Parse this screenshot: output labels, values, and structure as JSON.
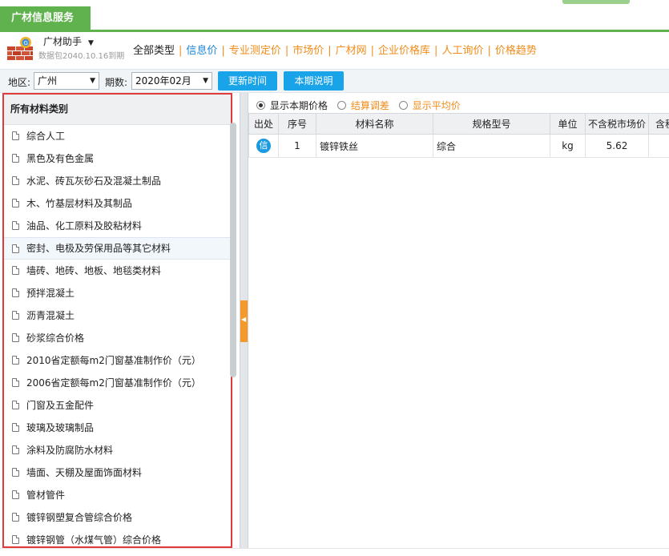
{
  "app": {
    "tab_label": "广材信息服务"
  },
  "header": {
    "assistant_label": "广材助手",
    "caret": "▼",
    "package_text": "数据包2040.10.16到期",
    "nav": [
      {
        "label": "全部类型",
        "style": "black"
      },
      {
        "label": "信息价",
        "style": "active"
      },
      {
        "label": "专业测定价",
        "style": "orange"
      },
      {
        "label": "市场价",
        "style": "orange"
      },
      {
        "label": "广材网",
        "style": "orange"
      },
      {
        "label": "企业价格库",
        "style": "orange"
      },
      {
        "label": "人工询价",
        "style": "orange"
      },
      {
        "label": "价格趋势",
        "style": "orange"
      }
    ]
  },
  "filter": {
    "region_label": "地区:",
    "region_value": "广州",
    "period_label": "期数:",
    "period_value": "2020年02月",
    "arrow": "▼",
    "update_button": "更新时间",
    "notes_button": "本期说明"
  },
  "left_panel": {
    "title": "所有材料类别",
    "items": [
      "综合人工",
      "黑色及有色金属",
      "水泥、砖瓦灰砂石及混凝土制品",
      "木、竹基层材料及其制品",
      "油品、化工原料及胶粘材料",
      "密封、电极及劳保用品等其它材料",
      "墙砖、地砖、地板、地毯类材料",
      "预拌混凝土",
      "沥青混凝土",
      "砂浆综合价格",
      "2010省定额每m2门窗基准制作价（元）",
      "2006省定额每m2门窗基准制作价（元）",
      "门窗及五金配件",
      "玻璃及玻璃制品",
      "涂料及防腐防水材料",
      "墙面、天棚及屋面饰面材料",
      "管材管件",
      "镀锌钢塑复合管综合价格",
      "镀锌钢管（水煤气管）综合价格"
    ],
    "highlighted_index": 5
  },
  "splitter": {
    "arrow": "◀"
  },
  "right_panel": {
    "radios": [
      {
        "label": "显示本期价格",
        "checked": true
      },
      {
        "label": "结算调差",
        "checked": false
      },
      {
        "label": "显示平均价",
        "checked": false
      }
    ],
    "columns": [
      "出处",
      "序号",
      "材料名称",
      "规格型号",
      "单位",
      "不含税市场价",
      "含税"
    ],
    "rows": [
      {
        "source": "信",
        "index": "1",
        "name": "镀锌铁丝",
        "spec": "综合",
        "unit": "kg",
        "price": "5.62",
        "tax_price": ""
      }
    ]
  }
}
